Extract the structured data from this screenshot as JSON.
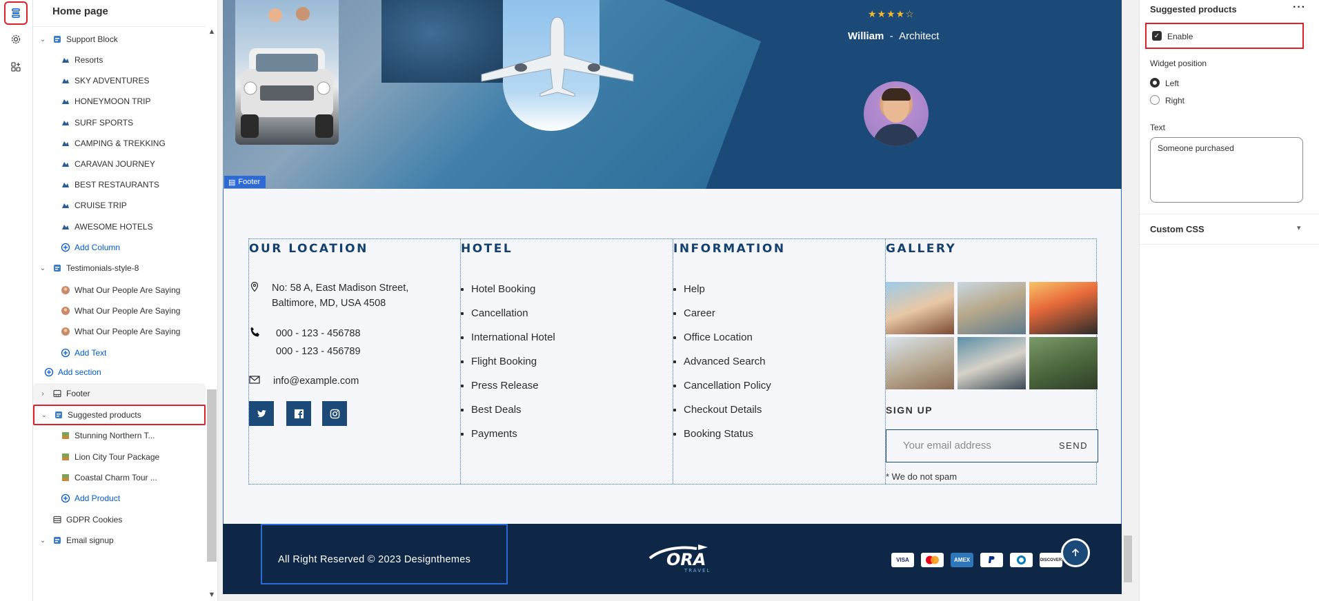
{
  "sidebar": {
    "title": "Home page",
    "items": [
      {
        "label": "Support Block",
        "level": 0,
        "icon": "section-icon",
        "chevron": "down"
      },
      {
        "label": "Resorts",
        "level": 1,
        "icon": "block-icon"
      },
      {
        "label": "SKY ADVENTURES",
        "level": 1,
        "icon": "block-icon"
      },
      {
        "label": "HONEYMOON TRIP",
        "level": 1,
        "icon": "block-icon"
      },
      {
        "label": "SURF SPORTS",
        "level": 1,
        "icon": "block-icon"
      },
      {
        "label": "CAMPING & TREKKING",
        "level": 1,
        "icon": "block-icon"
      },
      {
        "label": "CARAVAN JOURNEY",
        "level": 1,
        "icon": "block-icon"
      },
      {
        "label": "BEST RESTAURANTS",
        "level": 1,
        "icon": "block-icon"
      },
      {
        "label": "CRUISE TRIP",
        "level": 1,
        "icon": "block-icon"
      },
      {
        "label": "AWESOME HOTELS",
        "level": 1,
        "icon": "block-icon"
      },
      {
        "label": "Add Column",
        "level": 1,
        "icon": "plus-circle-icon",
        "link": true
      },
      {
        "label": "Testimonials-style-8",
        "level": 0,
        "icon": "section-icon",
        "chevron": "down"
      },
      {
        "label": "What Our People Are Saying",
        "level": 1,
        "icon": "avatar-icon"
      },
      {
        "label": "What Our People Are Saying",
        "level": 1,
        "icon": "avatar-icon"
      },
      {
        "label": "What Our People Are Saying",
        "level": 1,
        "icon": "avatar-icon"
      },
      {
        "label": "Add Text",
        "level": 1,
        "icon": "plus-circle-icon",
        "link": true
      },
      {
        "label": "Add section",
        "level": 0,
        "icon": "plus-circle-icon",
        "link": true
      },
      {
        "label": "Footer",
        "level": 0,
        "icon": "footer-icon",
        "chevron": "right",
        "highlight": true
      },
      {
        "label": "Suggested products",
        "level": 0,
        "icon": "section-icon",
        "chevron": "down",
        "selected": true
      },
      {
        "label": "Stunning Northern T...",
        "level": 1,
        "icon": "product-icon"
      },
      {
        "label": "Lion City Tour Package",
        "level": 1,
        "icon": "product-icon"
      },
      {
        "label": "Coastal Charm Tour ...",
        "level": 1,
        "icon": "product-icon"
      },
      {
        "label": "Add Product",
        "level": 1,
        "icon": "plus-circle-icon",
        "link": true
      },
      {
        "label": "GDPR Cookies",
        "level": 0,
        "icon": "cookie-icon"
      },
      {
        "label": "Email signup",
        "level": 0,
        "icon": "section-icon",
        "chevron": "down"
      }
    ]
  },
  "preview": {
    "testimonial": {
      "stars": "★★★★☆",
      "name": "William",
      "separator": "-",
      "role": "Architect"
    },
    "footer_tag": "Footer",
    "location": {
      "heading": "OUR LOCATION",
      "address_1": "No: 58 A, East Madison Street,",
      "address_2": "Baltimore, MD, USA 4508",
      "phone_1": "000 - 123 - 456788",
      "phone_2": "000 - 123 - 456789",
      "email": "info@example.com"
    },
    "hotel": {
      "heading": "HOTEL",
      "links": [
        "Hotel Booking",
        "Cancellation",
        "International Hotel",
        "Flight Booking",
        "Press Release",
        "Best Deals",
        "Payments"
      ]
    },
    "information": {
      "heading": "INFORMATION",
      "links": [
        "Help",
        "Career",
        "Office Location",
        "Advanced Search",
        "Cancellation Policy",
        "Checkout Details",
        "Booking Status"
      ]
    },
    "gallery": {
      "heading": "GALLERY",
      "signup_heading": "SIGN UP",
      "email_placeholder": "Your email address",
      "send_label": "SEND",
      "no_spam": "* We do not spam"
    },
    "bottom": {
      "copyright": "All Right Reserved © 2023 Designthemes",
      "logo_text": "ORA",
      "logo_sub": "TRAVEL",
      "payments": [
        "VISA",
        "MC",
        "AMEX",
        "PayPal",
        "Diners",
        "DISCOVER"
      ]
    }
  },
  "panel": {
    "title": "Suggested products",
    "more": "···",
    "enable_label": "Enable",
    "widget_position_label": "Widget position",
    "position_left": "Left",
    "position_right": "Right",
    "text_label": "Text",
    "text_value": "Someone purchased",
    "custom_css": "Custom CSS"
  },
  "colors": {
    "accent_red": "#e01e2a",
    "brand_navy": "#1b4a79",
    "link_blue": "#005bd3",
    "footer_dark": "#0f2747"
  }
}
